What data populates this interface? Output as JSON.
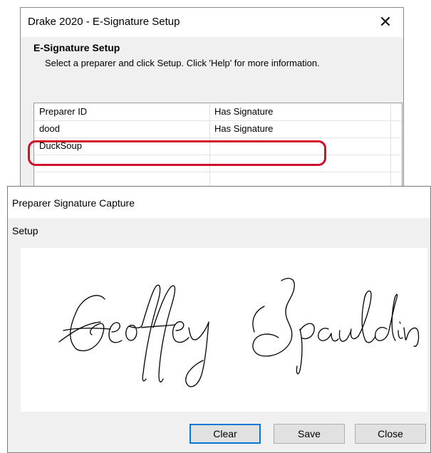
{
  "setup_window": {
    "title": "Drake 2020 - E-Signature Setup",
    "close_glyph": "✕",
    "heading": "E-Signature Setup",
    "description": "Select a preparer and click Setup. Click 'Help' for more information.",
    "columns": [
      "Preparer ID",
      "Has Signature"
    ],
    "rows": [
      {
        "preparer": "dood",
        "has_signature": "Has Signature"
      },
      {
        "preparer": "DuckSoup",
        "has_signature": ""
      }
    ],
    "highlight_color": "#d0112b"
  },
  "capture_window": {
    "title": "Preparer Signature Capture",
    "menu": {
      "setup": "Setup"
    },
    "signature_text": "Geoffrey Spaulding",
    "buttons": {
      "clear": "Clear",
      "save": "Save",
      "close": "Close"
    },
    "focus_color": "#0078d7"
  }
}
